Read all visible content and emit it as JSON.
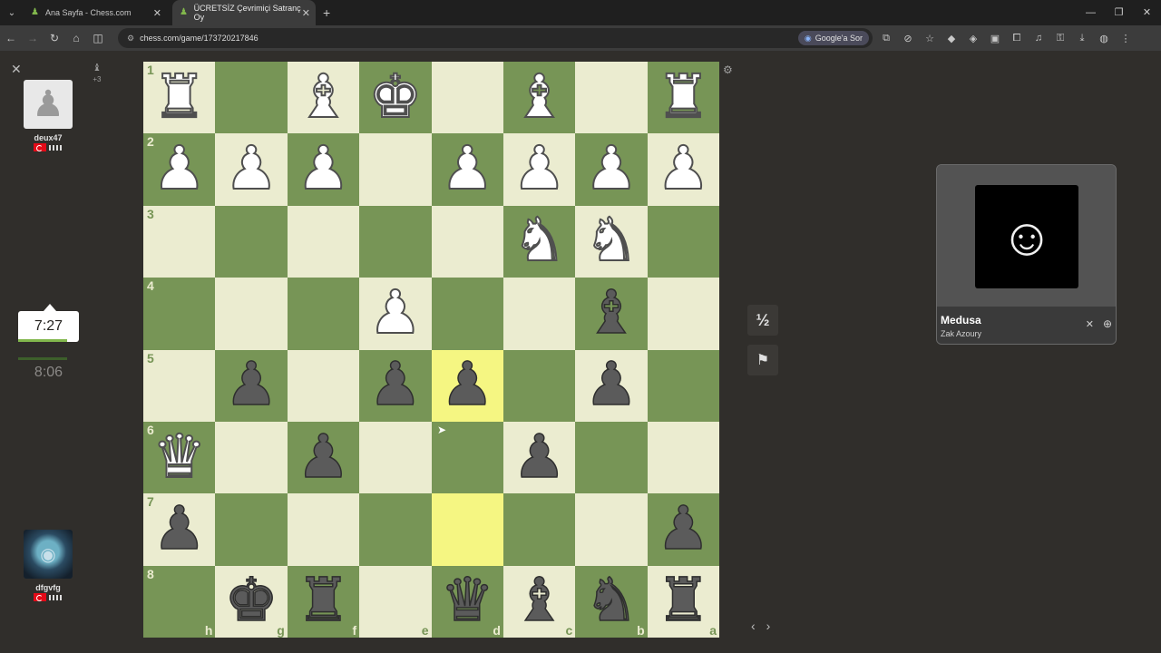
{
  "browser": {
    "tabs": [
      {
        "label": "Ana Sayfa - Chess.com"
      },
      {
        "label": "ÜCRETSİZ Çevrimiçi Satranç Oy"
      }
    ],
    "url": "chess.com/game/173720217846",
    "google_ask": "Google'a Sor"
  },
  "game": {
    "top_player": {
      "name": "deux47",
      "time": "7:27",
      "captured_advantage": "+3"
    },
    "bottom_player": {
      "name": "dfgvfg",
      "time": "8:06"
    },
    "draw_label": "½"
  },
  "board": {
    "colors": {
      "light": "#ebecd0",
      "dark": "#779556",
      "highlight": "#f5f682"
    },
    "ranks_top_to_bottom": [
      "1",
      "2",
      "3",
      "4",
      "5",
      "6",
      "7",
      "8"
    ],
    "files_left_to_right": [
      "h",
      "g",
      "f",
      "e",
      "d",
      "c",
      "b",
      "a"
    ],
    "highlighted": [
      [
        4,
        4
      ],
      [
        6,
        4
      ]
    ],
    "pieces": [
      [
        "wR",
        "",
        "wB",
        "wK",
        "",
        "wB",
        "",
        "wR"
      ],
      [
        "wP",
        "wP",
        "wP",
        "",
        "wP",
        "wP",
        "wP",
        "wP"
      ],
      [
        "",
        "",
        "",
        "",
        "",
        "wN",
        "wN",
        ""
      ],
      [
        "",
        "",
        "",
        "wP",
        "",
        "",
        "bB",
        ""
      ],
      [
        "",
        "bP",
        "",
        "bP",
        "bP",
        "",
        "bP",
        ""
      ],
      [
        "wQ",
        "",
        "bP",
        "",
        "",
        "bP",
        "",
        ""
      ],
      [
        "bP",
        "",
        "",
        "",
        "",
        "",
        "",
        "bP"
      ],
      [
        "",
        "bK",
        "bR",
        "",
        "bQ",
        "bB",
        "bN",
        "bR"
      ]
    ]
  },
  "media": {
    "title": "Medusa",
    "artist": "Zak Azoury"
  }
}
